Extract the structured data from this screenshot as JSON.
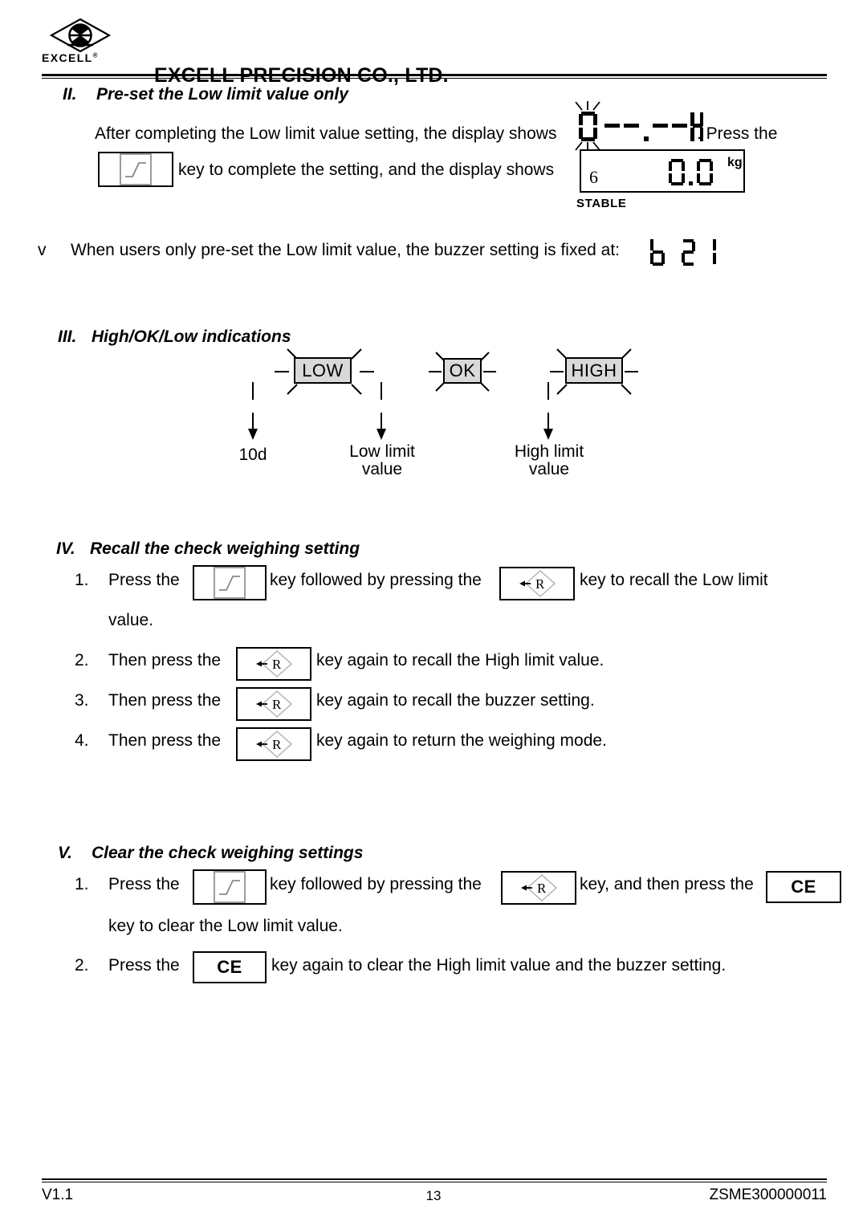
{
  "header": {
    "logo_word": "EXCELL",
    "logo_registered": "®",
    "logo_icon": "excell-diamond-logo",
    "company_name": "EXCELL PRECISION CO., LTD."
  },
  "footer": {
    "version": "V1.1",
    "page_number": "13",
    "doc_code": "ZSME300000011"
  },
  "sections": {
    "two": {
      "numeral": "II.",
      "title": "Pre-set the Low limit value only",
      "line1_before": "After completing the Low limit value setting, the display shows",
      "line1_after": ". Press the",
      "line2": "key to complete the setting, and the display shows",
      "display_preset": "0 - - . - - H",
      "note_bullet": "v",
      "note_text": "When users only pre-set the Low limit value, the buzzer setting is fixed at:",
      "note_value": "b 2 1"
    },
    "lcd": {
      "value": "0.0",
      "unit": "kg",
      "stable_label": "STABLE",
      "stable_arrow": "6"
    },
    "three": {
      "numeral": "III.",
      "title": "High/OK/Low indications",
      "badges": [
        {
          "label": "LOW"
        },
        {
          "label": "OK"
        },
        {
          "label": "HIGH"
        }
      ],
      "callouts": [
        {
          "line1": "10d",
          "line2": ""
        },
        {
          "line1": "Low limit",
          "line2": "value"
        },
        {
          "line1": "High limit",
          "line2": "value"
        }
      ]
    },
    "four": {
      "numeral": "IV.",
      "title": "Recall the check weighing setting",
      "steps": [
        {
          "num": "1.",
          "t1": "Press the",
          "t2": "key followed by pressing the",
          "t3": "key to recall the Low limit",
          "t4": "value."
        },
        {
          "num": "2.",
          "t1": "Then press the",
          "t2": "key again to recall the High limit value."
        },
        {
          "num": "3.",
          "t1": "Then press the",
          "t2": "key again to recall the buzzer setting."
        },
        {
          "num": "4.",
          "t1": "Then press the",
          "t2": "key again to return the weighing mode."
        }
      ]
    },
    "five": {
      "numeral": "V.",
      "title": "Clear the check weighing settings",
      "steps": [
        {
          "num": "1.",
          "t1": "Press the",
          "t2": "key followed by pressing the",
          "t3": "key, and then press the",
          "t4": "key to clear the Low limit value."
        },
        {
          "num": "2.",
          "t1": "Press the",
          "t2": "key again to clear the High limit value and the buzzer setting."
        }
      ]
    }
  },
  "keys": {
    "set_key": "set-ramp-key",
    "r_key_label": "R",
    "r_key_arrow": "←",
    "ce_key_label": "CE"
  },
  "colors": {
    "ink": "#000000",
    "badge_fill": "#d9d9d9",
    "key_inner_border": "#9d9d9d",
    "paper": "#ffffff"
  }
}
